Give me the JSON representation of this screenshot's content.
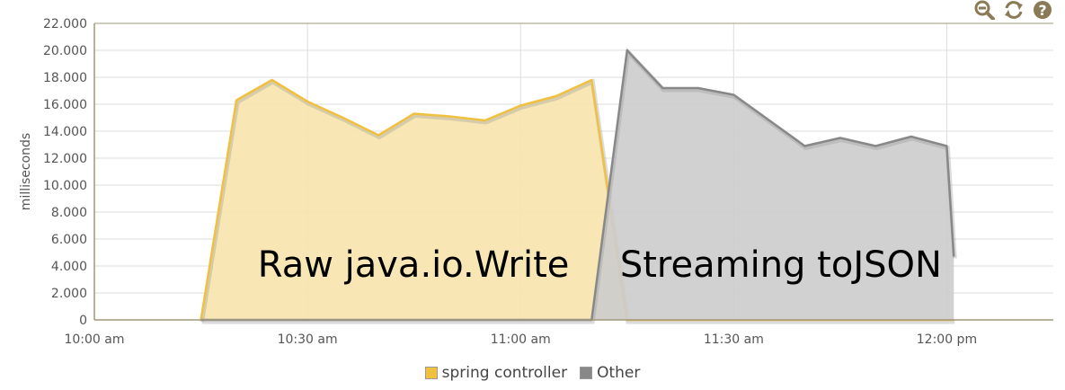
{
  "toolbar": {
    "zoom_icon": "zoom-out-icon",
    "refresh_icon": "refresh-icon",
    "help_icon": "help-icon"
  },
  "colors": {
    "spring": "#f0c040",
    "spring_fill": "#f7e4ac",
    "other": "#888888",
    "other_fill": "#cccccc",
    "axis": "#a09878",
    "grid": "#dddddd"
  },
  "legend": [
    {
      "label": "spring controller",
      "color": "#f0c040"
    },
    {
      "label": "Other",
      "color": "#888888"
    }
  ],
  "chart_data": {
    "type": "area",
    "ylabel": "milliseconds",
    "ylim": [
      0,
      22000
    ],
    "yticks": [
      "0",
      "2.000",
      "4.000",
      "6.000",
      "8.000",
      "10.000",
      "12.000",
      "14.000",
      "16.000",
      "18.000",
      "20.000",
      "22.000"
    ],
    "xlim": [
      "10:00",
      "12:15"
    ],
    "xticks": [
      {
        "t": "10:00",
        "label": "10:00 am"
      },
      {
        "t": "10:30",
        "label": "10:30 am"
      },
      {
        "t": "11:00",
        "label": "11:00 am"
      },
      {
        "t": "11:30",
        "label": "11:30 am"
      },
      {
        "t": "12:00",
        "label": "12:00 pm"
      }
    ],
    "legend_position": "bottom-center",
    "annotations": [
      {
        "text": "Raw java.io.Write",
        "t": "10:23"
      },
      {
        "text": "Streaming toJSON",
        "t": "11:14"
      }
    ],
    "series": [
      {
        "name": "spring controller",
        "points": [
          [
            "10:15",
            0
          ],
          [
            "10:20",
            16300
          ],
          [
            "10:25",
            17800
          ],
          [
            "10:30",
            16200
          ],
          [
            "10:35",
            15000
          ],
          [
            "10:40",
            13700
          ],
          [
            "10:45",
            15300
          ],
          [
            "10:50",
            15100
          ],
          [
            "10:55",
            14800
          ],
          [
            "11:00",
            15900
          ],
          [
            "11:05",
            16600
          ],
          [
            "11:10",
            17800
          ],
          [
            "11:15",
            0
          ],
          [
            "11:20",
            0
          ],
          [
            "11:25",
            0
          ],
          [
            "11:30",
            0
          ],
          [
            "11:35",
            0
          ],
          [
            "11:40",
            0
          ],
          [
            "11:45",
            0
          ],
          [
            "11:50",
            0
          ],
          [
            "11:55",
            0
          ],
          [
            "12:00",
            0
          ],
          [
            "12:01",
            0
          ]
        ]
      },
      {
        "name": "Other",
        "points": [
          [
            "10:15",
            0
          ],
          [
            "10:20",
            0
          ],
          [
            "10:25",
            0
          ],
          [
            "10:30",
            0
          ],
          [
            "10:35",
            0
          ],
          [
            "10:40",
            0
          ],
          [
            "10:45",
            0
          ],
          [
            "10:50",
            0
          ],
          [
            "10:55",
            0
          ],
          [
            "11:00",
            0
          ],
          [
            "11:05",
            0
          ],
          [
            "11:10",
            0
          ],
          [
            "11:15",
            20000
          ],
          [
            "11:20",
            17200
          ],
          [
            "11:25",
            17200
          ],
          [
            "11:30",
            16700
          ],
          [
            "11:35",
            14800
          ],
          [
            "11:40",
            12900
          ],
          [
            "11:45",
            13500
          ],
          [
            "11:50",
            12900
          ],
          [
            "11:55",
            13600
          ],
          [
            "12:00",
            12900
          ],
          [
            "12:01",
            4700
          ]
        ]
      }
    ]
  }
}
